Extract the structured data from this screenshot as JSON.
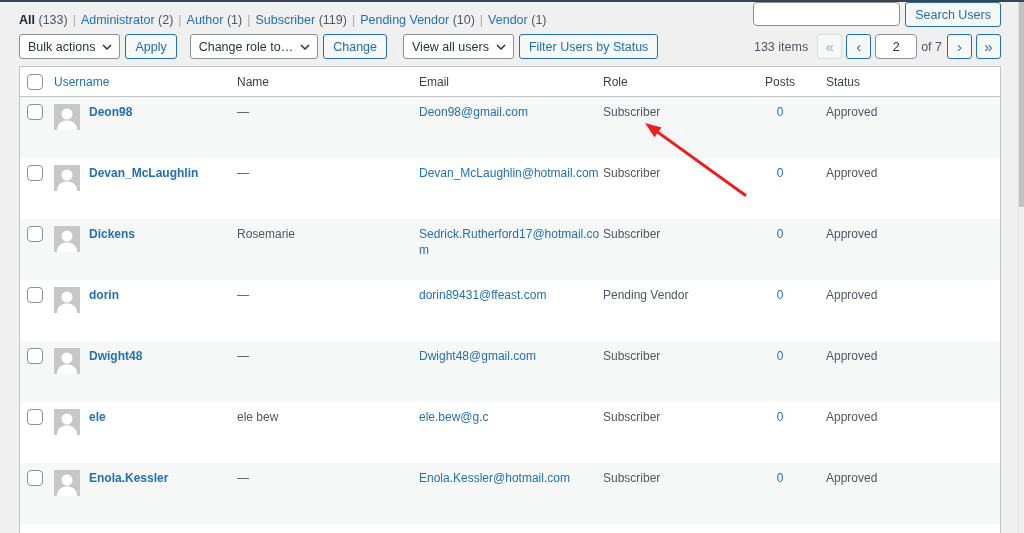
{
  "views": [
    {
      "label": "All",
      "count": "(133)",
      "selected": true,
      "separator": "|"
    },
    {
      "label": "Administrator",
      "count": "(2)",
      "selected": false,
      "separator": "|"
    },
    {
      "label": "Author",
      "count": "(1)",
      "selected": false,
      "separator": "|"
    },
    {
      "label": "Subscriber",
      "count": "(119)",
      "selected": false,
      "separator": "|"
    },
    {
      "label": "Pending Vendor",
      "count": "(10)",
      "selected": false,
      "separator": "|"
    },
    {
      "label": "Vendor",
      "count": "(1)",
      "selected": false
    }
  ],
  "search": {
    "button": "Search Users"
  },
  "bulk_actions": {
    "select": "Bulk actions",
    "button": "Apply"
  },
  "change_role": {
    "select": "Change role to…",
    "button": "Change"
  },
  "status_filter": {
    "select": "View all users",
    "button": "Filter Users by Status"
  },
  "pagination": {
    "count": "133 items",
    "first": {
      "label": "«",
      "disabled": true
    },
    "previous": {
      "label": "‹",
      "disabled": false
    },
    "page": "2",
    "total": "of 7",
    "next": {
      "label": "›",
      "disabled": false
    },
    "last": {
      "label": "»",
      "disabled": false
    }
  },
  "table": {
    "select_all_checked": false,
    "columns": [
      {
        "label": "Username",
        "link": true
      },
      {
        "label": "Name",
        "link": false
      },
      {
        "label": "Email",
        "link": false
      },
      {
        "label": "Role",
        "link": false
      },
      {
        "label": "Posts",
        "link": false
      },
      {
        "label": "Status",
        "link": false
      }
    ],
    "rows": [
      {
        "checked": false,
        "username": "Deon98",
        "name": "—",
        "email": "Deon98@gmail.com",
        "role": "Subscriber",
        "posts": "0",
        "status": "Approved"
      },
      {
        "checked": false,
        "username": "Devan_McLaughlin",
        "name": "—",
        "email": "Devan_McLaughlin@hotmail.com",
        "role": "Subscriber",
        "posts": "0",
        "status": "Approved"
      },
      {
        "checked": false,
        "username": "Dickens",
        "name": "Rosemarie",
        "email": "Sedrick.Rutherford17@hotmail.com",
        "role": "Subscriber",
        "posts": "0",
        "status": "Approved"
      },
      {
        "checked": false,
        "username": "dorin",
        "name": "—",
        "email": "dorin89431@ffeast.com",
        "role": "Pending Vendor",
        "posts": "0",
        "status": "Approved"
      },
      {
        "checked": false,
        "username": "Dwight48",
        "name": "—",
        "email": "Dwight48@gmail.com",
        "role": "Subscriber",
        "posts": "0",
        "status": "Approved"
      },
      {
        "checked": false,
        "username": "ele",
        "name": "ele bew",
        "email": "ele.bew@g.c",
        "role": "Subscriber",
        "posts": "0",
        "status": "Approved"
      },
      {
        "checked": false,
        "username": "Enola.Kessler",
        "name": "—",
        "email": "Enola.Kessler@hotmail.com",
        "role": "Subscriber",
        "posts": "0",
        "status": "Approved"
      }
    ]
  }
}
